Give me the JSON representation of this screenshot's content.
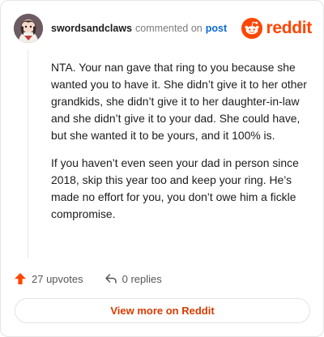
{
  "header": {
    "username": "swordsandclaws",
    "verb": "commented on",
    "post_link": "post",
    "brand": "reddit"
  },
  "comment": {
    "paragraphs": [
      "NTA. Your nan gave that ring to you because she wanted you to have it. She didn’t give it to her other grandkids, she didn’t give it to her daughter-in-law and she didn’t give it to your dad. She could have, but she wanted it to be yours, and it 100% is.",
      "If you haven’t even seen your dad in person since 2018, skip this year too and keep your ring. He’s made no effort for you, you don’t owe him a fickle compromise."
    ]
  },
  "actions": {
    "upvotes": "27 upvotes",
    "replies": "0 replies"
  },
  "footer": {
    "view_more": "View more on Reddit"
  },
  "icons": {
    "upvote": "upvote-arrow-icon",
    "reply": "reply-arrow-icon",
    "brand": "reddit-snoo-icon"
  },
  "colors": {
    "brand": "#ff4500",
    "link": "#0b6bd3",
    "view_more_text": "#d93a00"
  }
}
